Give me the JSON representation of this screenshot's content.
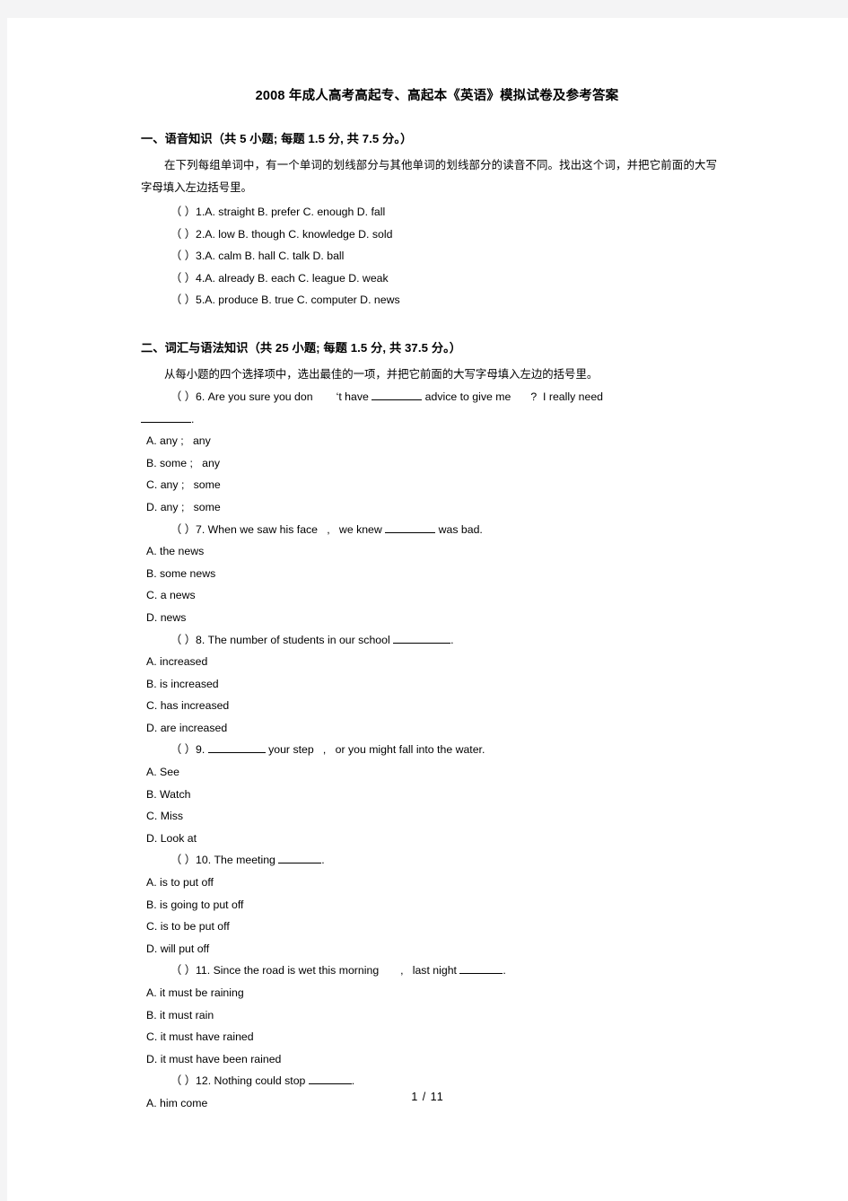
{
  "document": {
    "title": "2008 年成人高考高起专、高起本《英语》模拟试卷及参考答案",
    "page_number": "1 / 11"
  },
  "sections": [
    {
      "heading": "一、语音知识（共  5 小题; 每题  1.5 分, 共 7.5 分。）",
      "instruction": "在下列每组单词中，有一个单词的划线部分与其他单词的划线部分的读音不同。找出这个词，并把它前面的大写字母填入左边括号里。",
      "items": [
        "（ ）1.A. straight B. prefer C. enough D. fall",
        "（ ）2.A. low B. though C. knowledge D. sold",
        "（ ）3.A. calm B. hall C. talk D. ball",
        "（ ）4.A. already B. each C. league D. weak",
        "（ ）5.A. produce B. true C. computer D. news"
      ]
    },
    {
      "heading": "二、词汇与语法知识（共   25 小题; 每题  1.5 分, 共 37.5 分。）",
      "instruction": "从每小题的四个选择项中，选出最佳的一项，并把它前面的大写字母填入左边的括号里。"
    }
  ],
  "questions": [
    {
      "stem_part1": "（ ）6. Are you sure you don",
      "stem_apostrophe": "‘",
      "stem_part2": "t have ",
      "stem_part3": " advice to give me",
      "stem_part4": "?  I really need",
      "stem_wrap": ".",
      "options": [
        "A. any ;   any",
        "B. some ;   any",
        "C. any ;   some",
        "D. any ;   some"
      ]
    },
    {
      "stem": "（ ）7. When we saw his face   ,   we knew ",
      "stem_tail": " was bad.",
      "options": [
        "A. the news",
        "B. some news",
        "C. a news",
        "D. news"
      ]
    },
    {
      "stem": "（ ）8. The number of students in our school ",
      "stem_tail": ".",
      "options": [
        "A. increased",
        "B. is increased",
        "C. has increased",
        "D. are increased"
      ]
    },
    {
      "stem": "（ ）9. ",
      "stem_tail": " your step   ,   or you might fall into the water.",
      "options": [
        "A. See",
        "B. Watch",
        "C. Miss",
        "D. Look at"
      ]
    },
    {
      "stem": "（ ）10. The meeting ",
      "stem_tail": ".",
      "options": [
        "A. is to put off",
        "B. is going to put off",
        "C. is to be put off",
        "D. will put off"
      ]
    },
    {
      "stem": "（ ）11. Since the road is wet this morning       ,   last night ",
      "stem_tail": ".",
      "options": [
        "A. it must be raining",
        "B. it must rain",
        "C. it must have rained",
        "D. it must have been rained"
      ]
    },
    {
      "stem": "（ ）12. Nothing could stop ",
      "stem_tail": ".",
      "options": [
        "A. him come"
      ]
    }
  ]
}
